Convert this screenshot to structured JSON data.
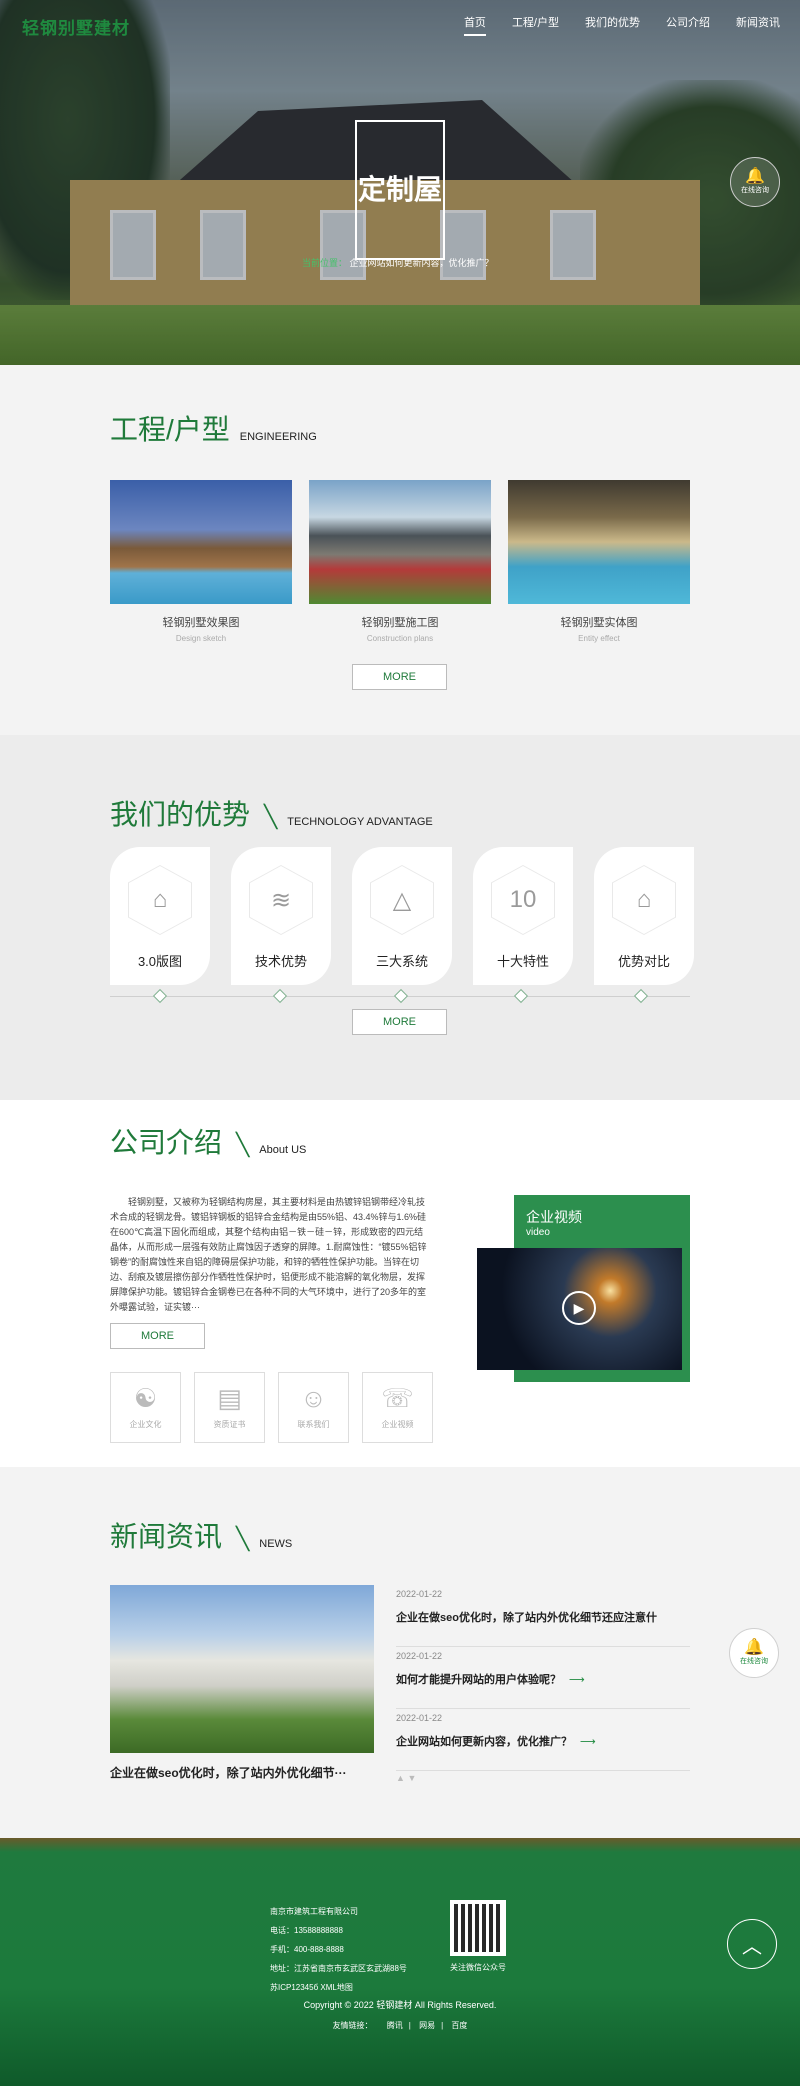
{
  "header": {
    "logo": "轻钢别墅建材",
    "nav": [
      "首页",
      "工程/户型",
      "我们的优势",
      "公司介绍",
      "新闻资讯"
    ]
  },
  "hero": {
    "title": "定制屋",
    "crumb_prefix": "当前位置：",
    "crumb_text": "企业网站如何更新内容，优化推广？"
  },
  "consult": {
    "label": "在线咨询"
  },
  "engineering": {
    "title_cn": "工程/户型",
    "title_en": "ENGINEERING",
    "cards": [
      {
        "title": "轻钢别墅效果图",
        "sub": "Design sketch"
      },
      {
        "title": "轻钢别墅施工图",
        "sub": "Construction plans"
      },
      {
        "title": "轻钢别墅实体图",
        "sub": "Entity effect"
      }
    ],
    "more": "MORE"
  },
  "advantage": {
    "title_cn": "我们的优势",
    "title_en": "TECHNOLOGY ADVANTAGE",
    "items": [
      {
        "label": "3.0版图",
        "icon": "house-icon"
      },
      {
        "label": "技术优势",
        "icon": "layers-icon"
      },
      {
        "label": "三大系统",
        "icon": "triangle-icon"
      },
      {
        "label": "十大特性",
        "icon": "ten-icon",
        "glyph": "10"
      },
      {
        "label": "优势对比",
        "icon": "houses-icon"
      }
    ],
    "more": "MORE"
  },
  "about": {
    "title_cn": "公司介绍",
    "title_en": "About US",
    "text": "轻钢别墅，又被称为轻钢结构房屋，其主要材料是由热镀锌铝钢带经冷轧技术合成的轻钢龙骨。镀铝锌钢板的铝锌合金结构是由55%铝、43.4%锌与1.6%硅在600℃高温下固化而组成，其整个结构由铝－铁－硅－锌，形成致密的四元结晶体，从而形成一层强有效防止腐蚀因子透穿的屏障。1.耐腐蚀性：“镀55%铝锌钢卷”的耐腐蚀性来自铝的障碍层保护功能，和锌的牺牲性保护功能。当锌在切边、刮痕及镀层擦伤部分作牺牲性保护时，铝便形成不能溶解的氧化物层，发挥屏障保护功能。镀铝锌合金钢卷已在各种不同的大气环境中，进行了20多年的室外曝露试验，证实镀···",
    "more": "MORE",
    "icons": [
      "企业文化",
      "资质证书",
      "联系我们",
      "企业视频"
    ],
    "video_title": "企业视频",
    "video_sub": "video"
  },
  "news": {
    "title_cn": "新闻资讯",
    "title_en": "NEWS",
    "feature_caption": "企业在做seo优化时，除了站内外优化细节···",
    "items": [
      {
        "date": "2022-01-22",
        "title": "企业在做seo优化时，除了站内外优化细节还应注意什"
      },
      {
        "date": "2022-01-22",
        "title": "如何才能提升网站的用户体验呢？"
      },
      {
        "date": "2022-01-22",
        "title": "企业网站如何更新内容，优化推广？"
      }
    ]
  },
  "footer": {
    "company": "南京市建筑工程有限公司",
    "phone": "电话：13588888888",
    "mobile": "手机：400-888-8888",
    "address": "地址：江苏省南京市玄武区玄武湖88号",
    "icp": "苏ICP12345б XML地图",
    "qr_caption": "关注微信公众号",
    "copyright": "Copyright © 2022 轻钢建材 All Rights Reserved.",
    "links_label": "友情链接：",
    "links": [
      "腾讯",
      "网易",
      "百度"
    ]
  }
}
